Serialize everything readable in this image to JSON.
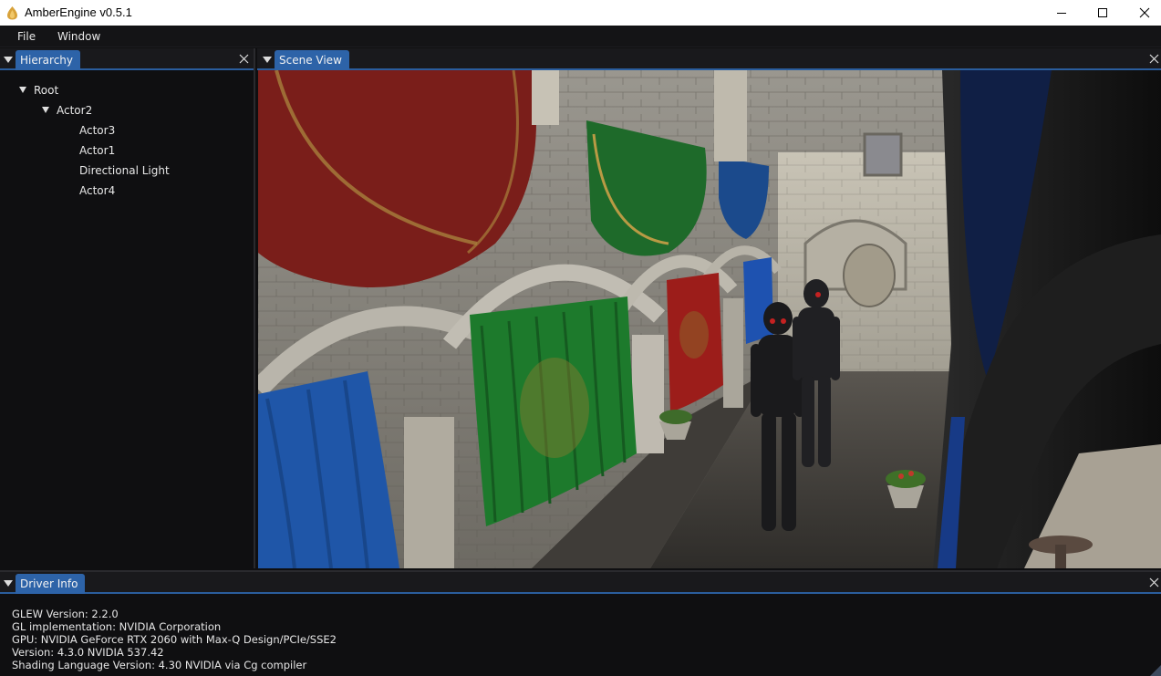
{
  "window": {
    "title": "AmberEngine v0.5.1",
    "controls": [
      "minimize",
      "maximize",
      "close"
    ]
  },
  "menu": {
    "items": [
      {
        "label": "File"
      },
      {
        "label": "Window"
      }
    ]
  },
  "hierarchy": {
    "tab_label": "Hierarchy",
    "tree": [
      {
        "label": "Root",
        "expanded": true,
        "depth": 0
      },
      {
        "label": "Actor2",
        "expanded": true,
        "depth": 1
      },
      {
        "label": "Actor3",
        "depth": 2
      },
      {
        "label": "Actor1",
        "depth": 2
      },
      {
        "label": "Directional Light",
        "depth": 2
      },
      {
        "label": "Actor4",
        "depth": 2
      }
    ]
  },
  "scene": {
    "tab_label": "Scene View",
    "viewport_icon": "3d-scene-render"
  },
  "driver": {
    "tab_label": "Driver Info",
    "lines": [
      "GLEW Version: 2.2.0",
      "GL implementation: NVIDIA Corporation",
      "GPU: NVIDIA GeForce RTX 2060 with Max-Q Design/PCIe/SSE2",
      "Version: 4.3.0 NVIDIA 537.42",
      "Shading Language Version: 4.30 NVIDIA via Cg compiler"
    ]
  },
  "colors": {
    "tab_active": "#2d63a8",
    "tab_underline": "#2a5d9d",
    "panel_bg": "#0f0f11",
    "text": "#e6e6e6"
  }
}
